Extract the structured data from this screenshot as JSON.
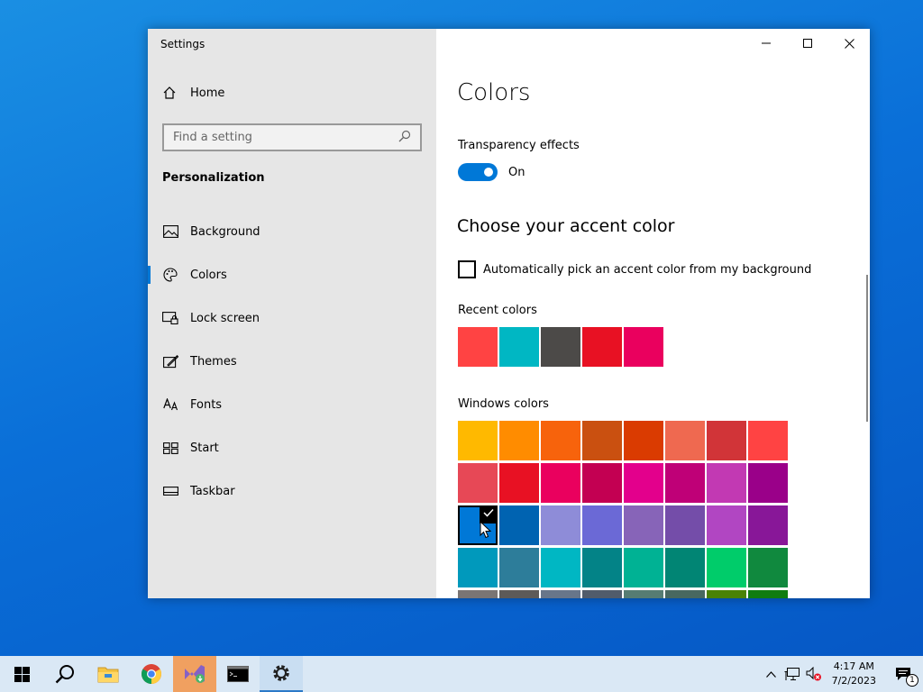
{
  "window": {
    "title": "Settings"
  },
  "nav": {
    "home_label": "Home",
    "search_placeholder": "Find a setting",
    "section_title": "Personalization",
    "items": [
      {
        "label": "Background",
        "icon": "picture-icon"
      },
      {
        "label": "Colors",
        "icon": "palette-icon",
        "active": true
      },
      {
        "label": "Lock screen",
        "icon": "lock-screen-icon"
      },
      {
        "label": "Themes",
        "icon": "themes-icon"
      },
      {
        "label": "Fonts",
        "icon": "fonts-icon"
      },
      {
        "label": "Start",
        "icon": "start-icon"
      },
      {
        "label": "Taskbar",
        "icon": "taskbar-icon"
      }
    ]
  },
  "content": {
    "title": "Colors",
    "transparency_label": "Transparency effects",
    "transparency_state": "On",
    "accent_heading": "Choose your accent color",
    "auto_pick_label": "Automatically pick an accent color from my background",
    "recent_label": "Recent colors",
    "recent_colors": [
      "#ff4343",
      "#00b7c3",
      "#4c4a48",
      "#e81123",
      "#ea005e"
    ],
    "windows_label": "Windows colors",
    "windows_colors": [
      "#ffb900",
      "#ff8c00",
      "#f7630c",
      "#ca5010",
      "#da3b01",
      "#ef6950",
      "#d13438",
      "#ff4343",
      "#e74856",
      "#e81123",
      "#ea005e",
      "#c30052",
      "#e3008c",
      "#bf0077",
      "#c239b3",
      "#9a0089",
      "#0078d7",
      "#0063b1",
      "#8e8cd8",
      "#6b69d6",
      "#8764b8",
      "#744da9",
      "#b146c2",
      "#881798",
      "#0099bc",
      "#2d7d9a",
      "#00b7c3",
      "#038387",
      "#00b294",
      "#018574",
      "#00cc6a",
      "#10893e",
      "#7a7574",
      "#5d5a58",
      "#68768a",
      "#515c6b",
      "#567c73",
      "#486860",
      "#498205",
      "#107c10"
    ],
    "selected_index": 16
  },
  "taskbar": {
    "time": "4:17 AM",
    "date": "7/2/2023",
    "notification_count": "1"
  }
}
